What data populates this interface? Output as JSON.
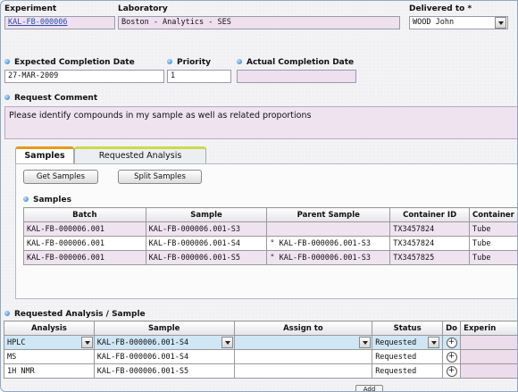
{
  "header": {
    "experiment_label": "Experiment",
    "experiment_value": "KAL-FB-000006",
    "laboratory_label": "Laboratory",
    "laboratory_value": "Boston - Analytics - SES",
    "delivered_label": "Delivered to *",
    "delivered_value": "WOOD John"
  },
  "dates": {
    "expected_label": "Expected Completion Date",
    "expected_value": "27-MAR-2009",
    "priority_label": "Priority",
    "priority_value": "1",
    "actual_label": "Actual Completion Date",
    "actual_value": ""
  },
  "comment": {
    "label": "Request Comment",
    "value": "Please identify compounds in my sample as well as related proportions"
  },
  "tabs": [
    {
      "label": "Samples",
      "active": true
    },
    {
      "label": "Requested Analysis",
      "active": false
    }
  ],
  "samples": {
    "get_button": "Get Samples",
    "split_button": "Split Samples",
    "section_label": "Samples",
    "columns": [
      "Batch",
      "Sample",
      "Parent Sample",
      "Container ID",
      "Container"
    ],
    "rows": [
      {
        "batch": "KAL-FB-000006.001",
        "sample": "KAL-FB-000006.001-S3",
        "parent": "",
        "container_id": "TX3457824",
        "container": "Tube"
      },
      {
        "batch": "KAL-FB-000006.001",
        "sample": "KAL-FB-000006.001-S4",
        "parent": "° KAL-FB-000006.001-S3",
        "container_id": "TX3457824",
        "container": "Tube"
      },
      {
        "batch": "KAL-FB-000006.001",
        "sample": "KAL-FB-000006.001-S5",
        "parent": "° KAL-FB-000006.001-S3",
        "container_id": "TX3457825",
        "container": "Tube"
      }
    ]
  },
  "analysis": {
    "section_label": "Requested Analysis / Sample",
    "columns": [
      "Analysis",
      "Sample",
      "Assign to",
      "Status",
      "Do",
      "Experin"
    ],
    "rows": [
      {
        "analysis": "HPLC",
        "sample": "KAL-FB-000006.001-S4",
        "assign": "",
        "status": "Requested",
        "do": "+"
      },
      {
        "analysis": "MS",
        "sample": "KAL-FB-000006.001-S4",
        "assign": "",
        "status": "Requested",
        "do": "+"
      },
      {
        "analysis": "1H NMR",
        "sample": "KAL-FB-000006.001-S5",
        "assign": "",
        "status": "Requested",
        "do": "+"
      }
    ],
    "add_button": "Add"
  }
}
